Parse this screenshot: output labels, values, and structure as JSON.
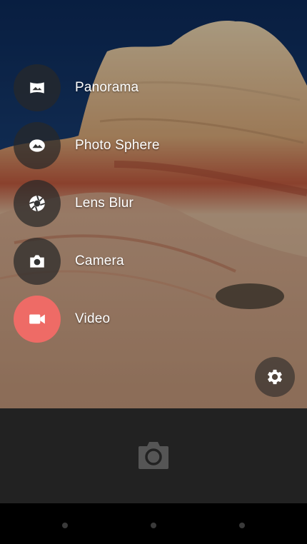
{
  "modes": [
    {
      "label": "Panorama",
      "icon": "panorama-icon"
    },
    {
      "label": "Photo Sphere",
      "icon": "photo-sphere-icon"
    },
    {
      "label": "Lens Blur",
      "icon": "lens-blur-icon"
    },
    {
      "label": "Camera",
      "icon": "camera-icon"
    },
    {
      "label": "Video",
      "icon": "video-icon",
      "active": true
    }
  ],
  "colors": {
    "accent": "#ee6b66",
    "bottom_bar": "#222222",
    "nav_bar": "#000000"
  },
  "settings_icon": "gear-icon",
  "shutter_icon": "camera-shutter-icon",
  "nav_icons": [
    "back-icon",
    "home-icon",
    "recents-icon"
  ]
}
